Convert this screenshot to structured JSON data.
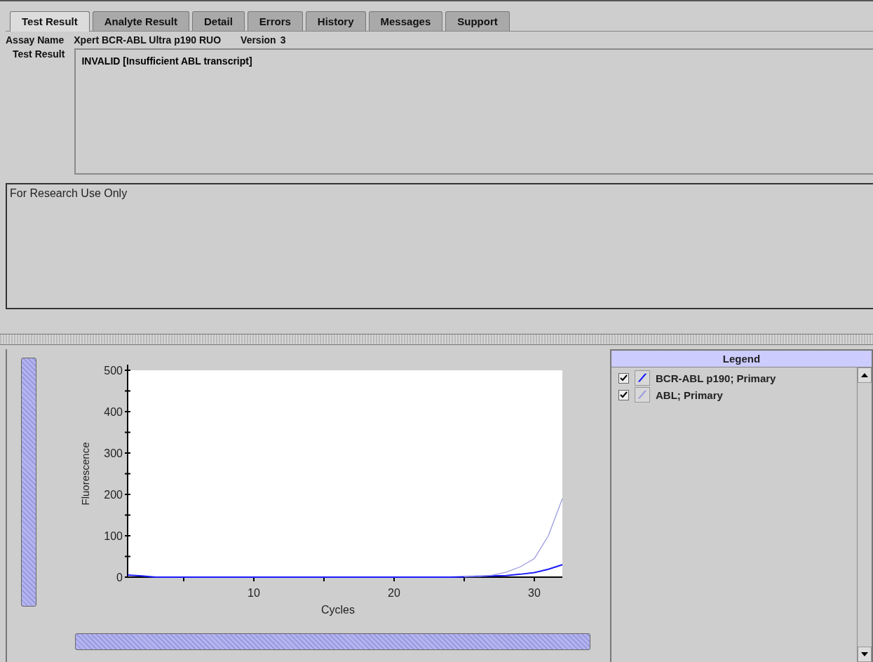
{
  "tabs": [
    {
      "label": "Test Result",
      "selected": true
    },
    {
      "label": "Analyte Result",
      "selected": false
    },
    {
      "label": "Detail",
      "selected": false
    },
    {
      "label": "Errors",
      "selected": false
    },
    {
      "label": "History",
      "selected": false
    },
    {
      "label": "Messages",
      "selected": false
    },
    {
      "label": "Support",
      "selected": false
    }
  ],
  "assay": {
    "label": "Assay Name",
    "value": "Xpert BCR-ABL Ultra p190 RUO",
    "version_label": "Version",
    "version": "3"
  },
  "test_result": {
    "label": "Test Result",
    "value": "INVALID [Insufficient ABL transcript]"
  },
  "notes": "For Research Use Only",
  "chart": {
    "chart_data": {
      "type": "line",
      "xlabel": "Cycles",
      "ylabel": "Fluorescence",
      "xlim": [
        1,
        32
      ],
      "ylim": [
        0,
        500
      ],
      "xticks": [
        10,
        20,
        30
      ],
      "yticks": [
        0,
        100,
        200,
        300,
        400,
        500
      ],
      "x": [
        1,
        2,
        3,
        4,
        5,
        6,
        7,
        8,
        9,
        10,
        11,
        12,
        13,
        14,
        15,
        16,
        17,
        18,
        19,
        20,
        21,
        22,
        23,
        24,
        25,
        26,
        27,
        28,
        29,
        30,
        31,
        32
      ],
      "series": [
        {
          "name": "BCR-ABL p190; Primary",
          "color": "#1a1aff",
          "values": [
            5,
            3,
            0,
            0,
            0,
            0,
            0,
            0,
            0,
            0,
            0,
            0,
            0,
            0,
            0,
            0,
            0,
            0,
            0,
            0,
            0,
            0,
            0,
            0,
            1,
            2,
            3,
            4,
            7,
            11,
            19,
            30
          ]
        },
        {
          "name": "ABL; Primary",
          "color": "#9a9ae0",
          "values": [
            null,
            null,
            null,
            null,
            null,
            null,
            null,
            null,
            null,
            null,
            null,
            null,
            null,
            null,
            null,
            null,
            null,
            null,
            null,
            null,
            null,
            null,
            null,
            null,
            1,
            2,
            5,
            12,
            25,
            45,
            100,
            190
          ]
        }
      ]
    }
  },
  "legend": {
    "title": "Legend",
    "items": [
      {
        "checked": true
      },
      {
        "checked": true
      }
    ]
  }
}
